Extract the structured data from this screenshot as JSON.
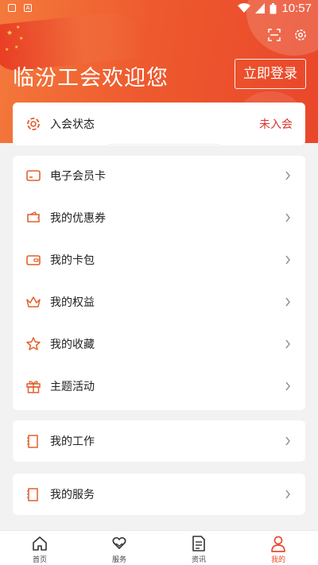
{
  "status_bar": {
    "time": "10:57"
  },
  "header": {
    "welcome_text": "临汾工会欢迎您",
    "login_button": "立即登录"
  },
  "membership": {
    "label": "入会状态",
    "value": "未入会"
  },
  "menu_main": [
    {
      "label": "电子会员卡",
      "icon": "card-icon"
    },
    {
      "label": "我的优惠券",
      "icon": "coupon-icon"
    },
    {
      "label": "我的卡包",
      "icon": "wallet-icon"
    },
    {
      "label": "我的权益",
      "icon": "crown-icon"
    },
    {
      "label": "我的收藏",
      "icon": "star-icon"
    },
    {
      "label": "主题活动",
      "icon": "gift-icon"
    }
  ],
  "menu_work": {
    "label": "我的工作",
    "icon": "notebook-icon"
  },
  "menu_service": {
    "label": "我的服务",
    "icon": "notebook-icon"
  },
  "tabbar": [
    {
      "label": "首页",
      "icon": "home-icon",
      "active": false
    },
    {
      "label": "服务",
      "icon": "heart-hands-icon",
      "active": false
    },
    {
      "label": "资讯",
      "icon": "document-icon",
      "active": false
    },
    {
      "label": "我的",
      "icon": "person-icon",
      "active": true
    }
  ],
  "colors": {
    "accent": "#e94a2c",
    "header_gradient_start": "#f47a3c",
    "header_gradient_end": "#e9472b",
    "icon": "#e0602e"
  }
}
